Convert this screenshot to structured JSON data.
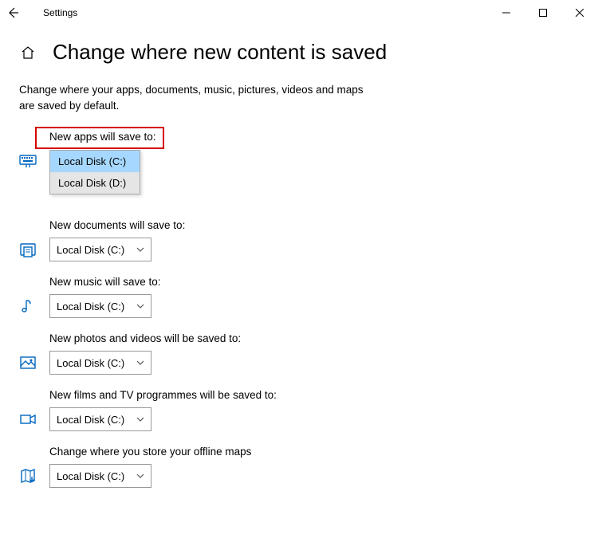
{
  "titlebar": {
    "title": "Settings"
  },
  "header": {
    "title": "Change where new content is saved"
  },
  "description": "Change where your apps, documents, music, pictures, videos and maps are saved by default.",
  "sections": {
    "apps": {
      "label": "New apps will save to:",
      "selected": "Local Disk (C:)",
      "options": [
        "Local Disk (C:)",
        "Local Disk (D:)"
      ]
    },
    "documents": {
      "label": "New documents will save to:",
      "selected": "Local Disk (C:)"
    },
    "music": {
      "label": "New music will save to:",
      "selected": "Local Disk (C:)"
    },
    "photos": {
      "label": "New photos and videos will be saved to:",
      "selected": "Local Disk (C:)"
    },
    "films": {
      "label": "New films and TV programmes will be saved to:",
      "selected": "Local Disk (C:)"
    },
    "maps": {
      "label": "Change where you store your offline maps",
      "selected": "Local Disk (C:)"
    }
  }
}
